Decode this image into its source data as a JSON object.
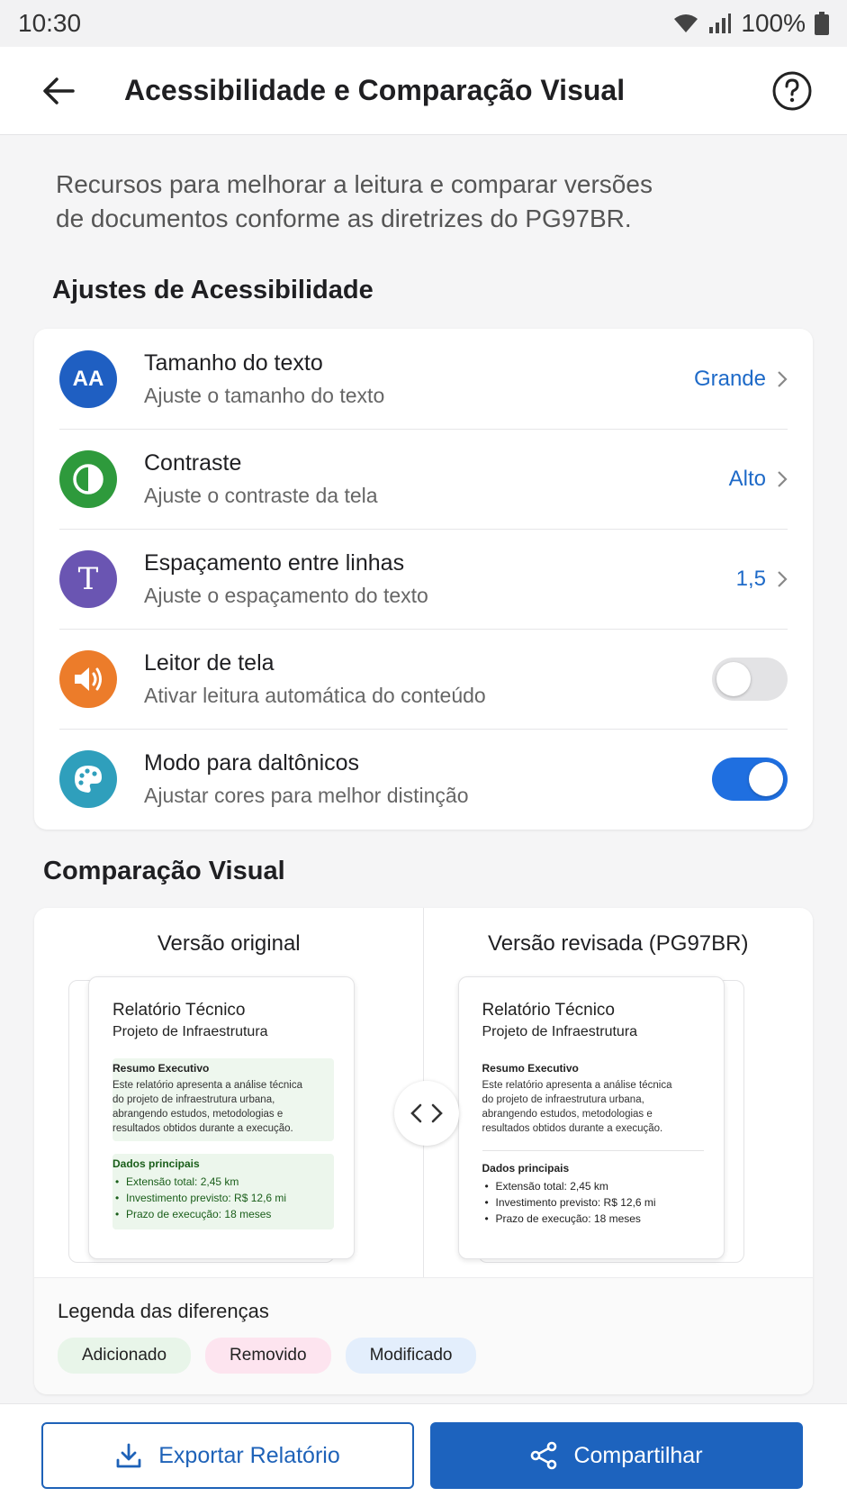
{
  "status_bar": {
    "time": "10:30",
    "battery": "100%"
  },
  "header": {
    "title": "Acessibilidade e Comparação Visual"
  },
  "intro": {
    "line1": "Recursos para melhorar a leitura e comparar versões",
    "line2": "de documentos conforme as diretrizes do PG97BR."
  },
  "accessibility": {
    "section_title": "Ajustes de Acessibilidade",
    "items": [
      {
        "title": "Tamanho do texto",
        "subtitle": "Ajuste o tamanho do texto",
        "value": "Grande",
        "icon": "text-size-icon",
        "icon_text": "AA",
        "color": "#1f5fc2"
      },
      {
        "title": "Contraste",
        "subtitle": "Ajuste o contraste da tela",
        "value": "Alto",
        "icon": "contrast-icon",
        "color": "#2e9a3c"
      },
      {
        "title": "Espaçamento entre linhas",
        "subtitle": "Ajuste o espaçamento do texto",
        "value": "1,5",
        "icon": "line-spacing-icon",
        "icon_text": "T",
        "color": "#6a55b2"
      },
      {
        "title": "Leitor de tela",
        "subtitle": "Ativar leitura automática do conteúdo",
        "toggle": false,
        "icon": "speaker-icon",
        "color": "#ec7c2a"
      },
      {
        "title": "Modo para daltônicos",
        "subtitle": "Ajustar cores para melhor distinção",
        "toggle": true,
        "icon": "palette-icon",
        "color": "#2f9fbc"
      }
    ]
  },
  "comparison": {
    "section_title": "Comparação Visual",
    "original": {
      "label": "Versão original",
      "doc_title": "Relatório Técnico",
      "doc_subtitle": "Projeto de Infraestrutura",
      "summary_title": "Resumo Executivo",
      "summary_lines": [
        "Este relatório apresenta a análise técnica",
        "do projeto de infraestrutura urbana,",
        "abrangendo estudos, metodologias e",
        "resultados obtidos durante a execução."
      ],
      "data_title": "Dados principais",
      "data_items": [
        "Extensão total: 2,45 km",
        "Investimento previsto: R$ 12,6 mi",
        "Prazo de execução: 18 meses"
      ]
    },
    "revised": {
      "label": "Versão revisada (PG97BR)",
      "doc_title": "Relatório Técnico",
      "doc_subtitle": "Projeto de Infraestrutura",
      "summary_title": "Resumo Executivo",
      "summary_lines": [
        "Este relatório apresenta a análise técnica",
        "do projeto de infraestrutura urbana,",
        "abrangendo estudos, metodologias e",
        "resultados obtidos durante a execução."
      ],
      "data_title": "Dados principais",
      "data_items": [
        "Extensão total: 2,45 km",
        "Investimento previsto: R$ 12,6 mi",
        "Prazo de execução: 18 meses"
      ]
    },
    "legend": {
      "title": "Legenda das diferenças",
      "chips": [
        {
          "label": "Adicionado",
          "color": "#e8f5e9"
        },
        {
          "label": "Removido",
          "color": "#fde4ef"
        },
        {
          "label": "Modificado",
          "color": "#e3eefc"
        }
      ]
    }
  },
  "actions": {
    "export_label": "Exportar Relatório",
    "share_label": "Compartilhar"
  }
}
